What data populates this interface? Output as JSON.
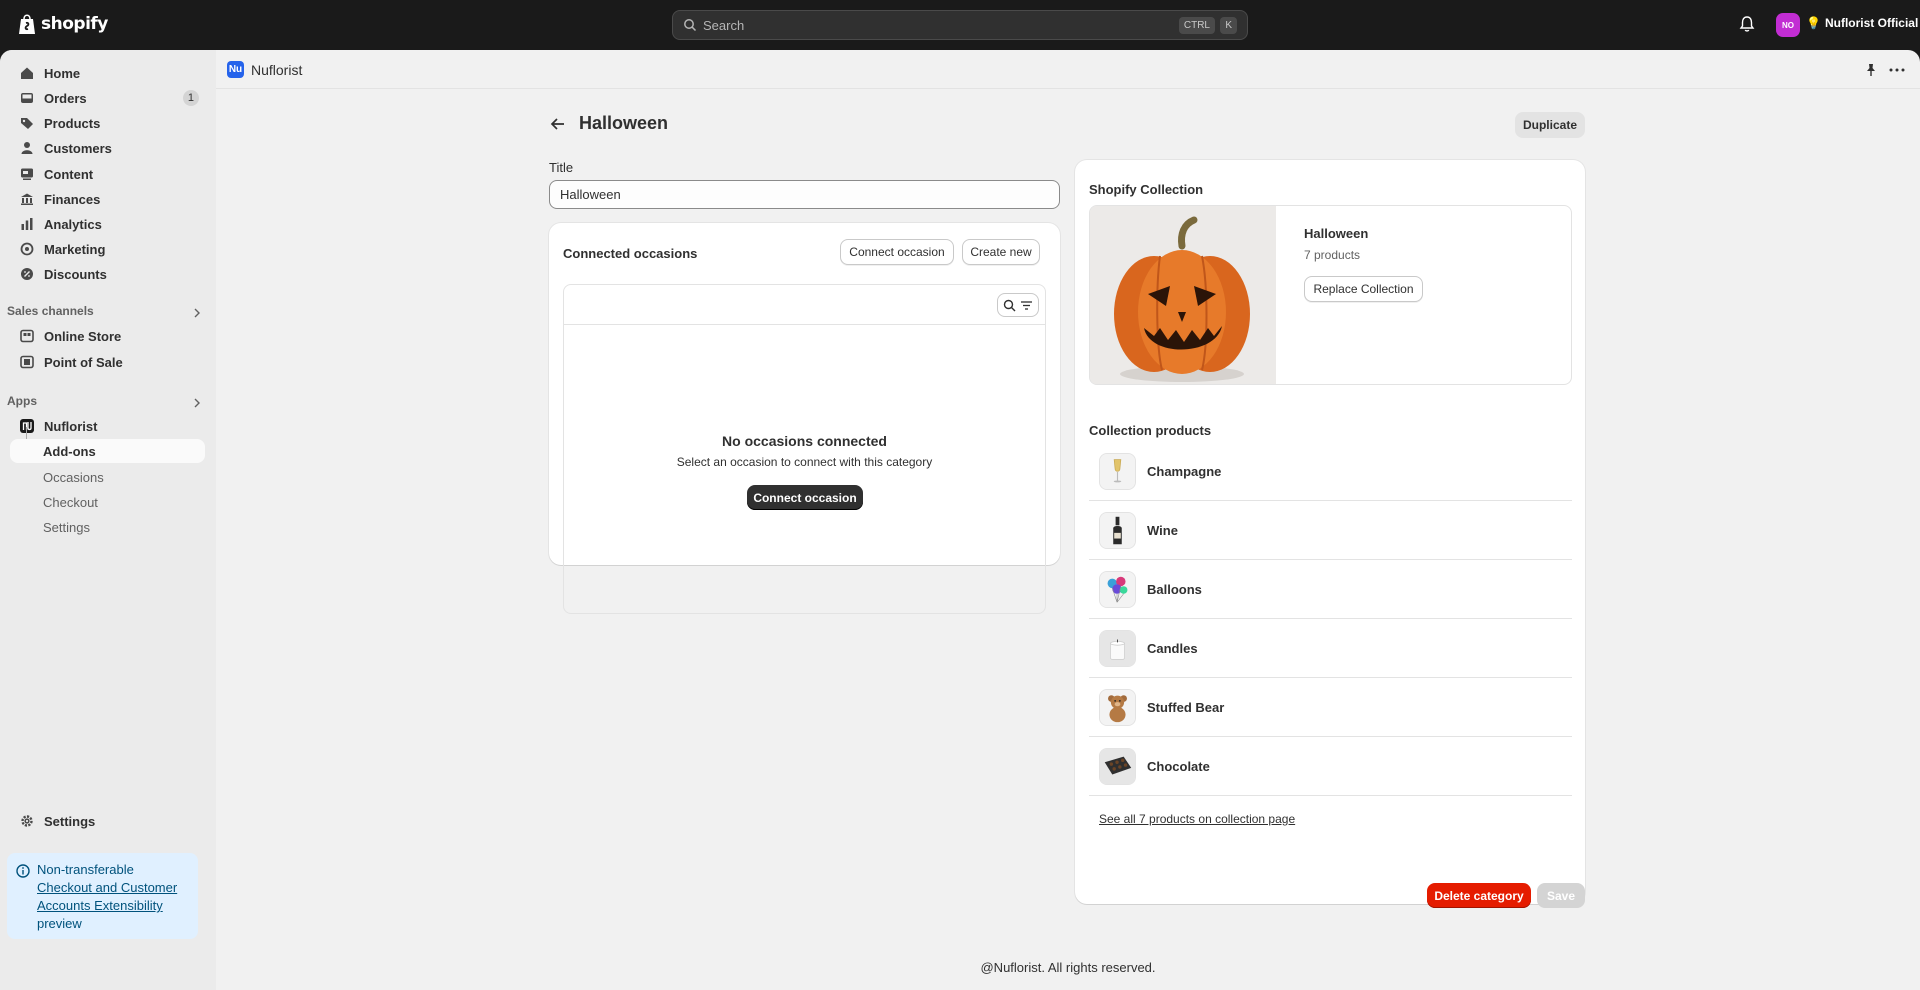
{
  "topbar": {
    "brand": "shopify",
    "search_placeholder": "Search",
    "kbd_ctrl": "CTRL",
    "kbd_k": "K",
    "store_initials": "NO",
    "store_name": "Nuflorist Official"
  },
  "sidebar": {
    "main": [
      {
        "label": "Home",
        "icon": "home-icon"
      },
      {
        "label": "Orders",
        "icon": "orders-icon",
        "count": "1"
      },
      {
        "label": "Products",
        "icon": "tag-icon"
      },
      {
        "label": "Customers",
        "icon": "person-icon"
      },
      {
        "label": "Content",
        "icon": "content-icon"
      },
      {
        "label": "Finances",
        "icon": "bank-icon"
      },
      {
        "label": "Analytics",
        "icon": "chart-icon"
      },
      {
        "label": "Marketing",
        "icon": "target-icon"
      },
      {
        "label": "Discounts",
        "icon": "discount-icon"
      }
    ],
    "sales_channels_label": "Sales channels",
    "sales_channels": [
      {
        "label": "Online Store",
        "icon": "store-icon"
      },
      {
        "label": "Point of Sale",
        "icon": "pos-icon"
      }
    ],
    "apps_label": "Apps",
    "app": {
      "label": "Nuflorist",
      "icon": "nuflorist-icon"
    },
    "app_sub": [
      "Add-ons",
      "Occasions",
      "Checkout",
      "Settings"
    ],
    "settings_label": "Settings",
    "banner": {
      "prefix": "Non-transferable",
      "link": "Checkout and Customer Accounts Extensibility",
      "suffix": "preview"
    }
  },
  "appbar": {
    "title": "Nuflorist",
    "logo_text": "Nu"
  },
  "page": {
    "title": "Halloween",
    "duplicate_label": "Duplicate",
    "title_field_label": "Title",
    "title_field_value": "Halloween"
  },
  "occasions": {
    "title": "Connected occasions",
    "connect_label": "Connect occasion",
    "create_label": "Create new",
    "empty_title": "No occasions connected",
    "empty_sub": "Select an occasion to connect with this category",
    "empty_button": "Connect occasion"
  },
  "collection": {
    "title": "Shopify Collection",
    "name": "Halloween",
    "count": "7 products",
    "replace_label": "Replace Collection",
    "products_title": "Collection products",
    "products": [
      {
        "name": "Champagne",
        "thumb": "champagne"
      },
      {
        "name": "Wine",
        "thumb": "wine"
      },
      {
        "name": "Balloons",
        "thumb": "balloons"
      },
      {
        "name": "Candles",
        "thumb": "candle"
      },
      {
        "name": "Stuffed Bear",
        "thumb": "bear"
      },
      {
        "name": "Chocolate",
        "thumb": "chocolate"
      }
    ],
    "see_all": "See all 7 products on collection page"
  },
  "actions": {
    "delete_label": "Delete category",
    "save_label": "Save"
  },
  "footer": "@Nuflorist. All rights reserved.",
  "colors": {
    "accent_dark": "#303030",
    "critical": "#e51c00",
    "app_blue": "#2563eb",
    "store_badge": "#c22dd3"
  }
}
